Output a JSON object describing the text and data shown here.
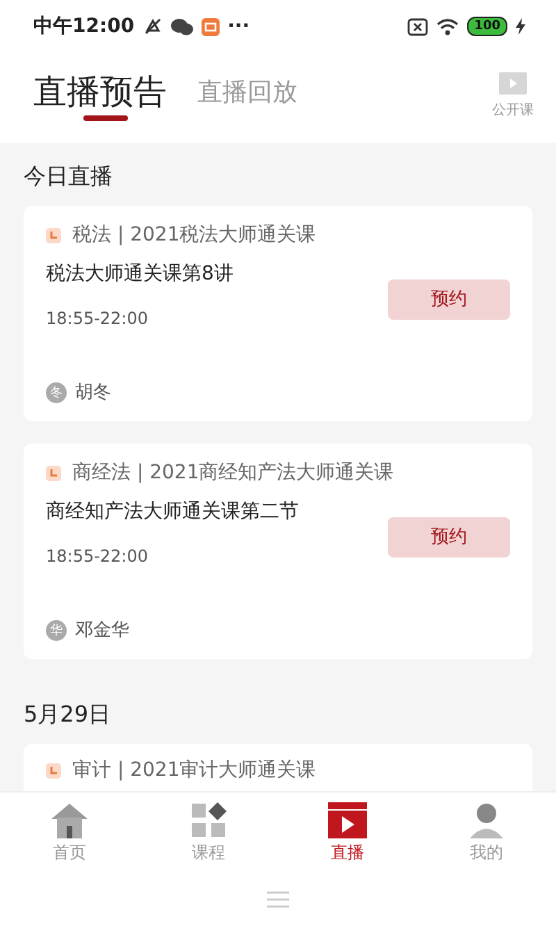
{
  "status_bar": {
    "time": "中午12:00",
    "more": "···",
    "battery": "100"
  },
  "header": {
    "tabs": [
      {
        "label": "直播预告",
        "selected": true
      },
      {
        "label": "直播回放",
        "selected": false
      }
    ],
    "open_class": "公开课"
  },
  "sections": [
    {
      "date": "今日直播",
      "courses": [
        {
          "category": "税法 | 2021税法大师通关课",
          "title": "税法大师通关课第8讲",
          "time": "18:55-22:00",
          "teacher": "胡冬",
          "avatar": "冬",
          "action": "预约"
        },
        {
          "category": "商经法 | 2021商经知产法大师通关课",
          "title": "商经知产法大师通关课第二节",
          "time": "18:55-22:00",
          "teacher": "邓金华",
          "avatar": "华",
          "action": "预约"
        }
      ]
    },
    {
      "date": "5月29日",
      "courses": [
        {
          "category": "审计 | 2021审计大师通关课"
        }
      ]
    }
  ],
  "bottom_nav": [
    {
      "label": "首页",
      "kind": "home",
      "selected": false
    },
    {
      "label": "课程",
      "kind": "courses",
      "selected": false
    },
    {
      "label": "直播",
      "kind": "live",
      "selected": true
    },
    {
      "label": "我的",
      "kind": "me",
      "selected": false
    }
  ]
}
